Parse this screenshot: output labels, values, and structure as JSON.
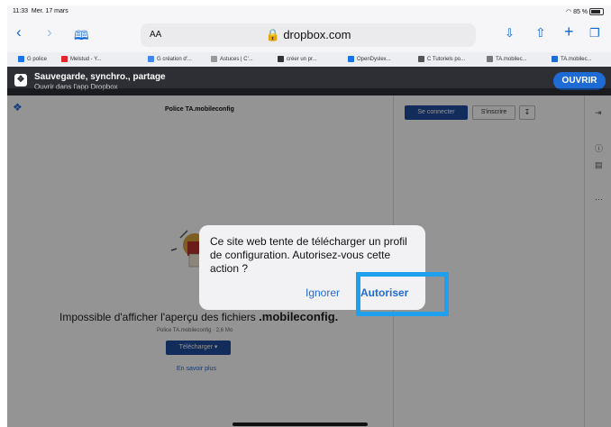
{
  "status": {
    "time": "11:33",
    "date": "Mer. 17 mars",
    "battery": "85 %"
  },
  "toolbar": {
    "back_icon": "chevron-left-icon",
    "forward_icon": "chevron-right-icon",
    "bookmarks_icon": "book-icon",
    "aa": "AA",
    "url": "dropbox.com",
    "download_icon": "download-icon",
    "share_icon": "share-icon",
    "new_tab_icon": "plus-icon",
    "tabs_icon": "tabs-icon"
  },
  "bookmarks": [
    {
      "label": "G police",
      "color": "#1a73e8"
    },
    {
      "label": "Melstud - Y...",
      "color": "#e8222b"
    },
    {
      "label": "G création d'...",
      "color": "#4285f4"
    },
    {
      "label": "Astuces | C'...",
      "color": "#999999"
    },
    {
      "label": "créer un pr...",
      "color": "#333333"
    },
    {
      "label": "OpenDyslex...",
      "color": "#1a73e8"
    },
    {
      "label": "C Tutoriels po...",
      "color": "#555555"
    },
    {
      "label": "TA.mobilec...",
      "color": "#777777"
    },
    {
      "label": "TA.mobilec...",
      "color": "#1f6bd6"
    }
  ],
  "banner": {
    "title": "Sauvegarde, synchro., partage",
    "subtitle": "Ouvrir dans l'app Dropbox",
    "open_label": "OUVRIR"
  },
  "page": {
    "file_title": "Police TA.mobileconfig",
    "connect_label": "Se connecter",
    "signup_label": "S'inscrire",
    "preview_message": "Impossible d'afficher l'aperçu des fichiers",
    "preview_ext": ".mobileconfig.",
    "file_meta": "Police TA.mobileconfig · 2,6 Mo",
    "download_label": "Télécharger ▾",
    "learn_more": "En savoir plus"
  },
  "dialog": {
    "message": "Ce site web tente de télécharger un profil de configuration. Autorisez-vous cette action ?",
    "ignore_label": "Ignorer",
    "allow_label": "Autoriser"
  },
  "colors": {
    "accent": "#1f6bd6",
    "highlight": "#1ea0ee",
    "banner": "#2e2f35"
  }
}
